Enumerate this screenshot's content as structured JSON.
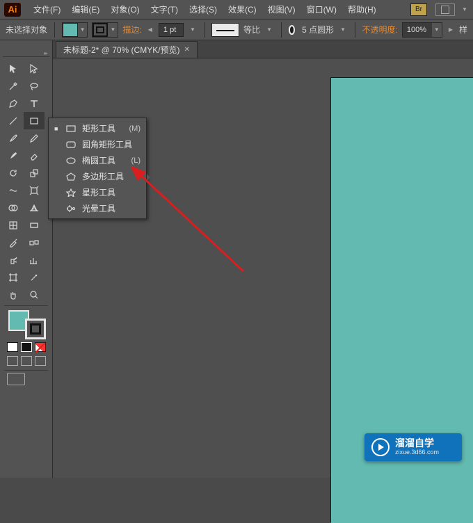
{
  "menubar": {
    "items": [
      "文件(F)",
      "编辑(E)",
      "对象(O)",
      "文字(T)",
      "选择(S)",
      "效果(C)",
      "视图(V)",
      "窗口(W)",
      "帮助(H)"
    ],
    "br_chip": "Br"
  },
  "controlbar": {
    "no_selection": "未选择对象",
    "stroke_label": "描边:",
    "stroke_value": "1 pt",
    "uniform_label": "等比",
    "brush_label": "5 点圆形",
    "opacity_label": "不透明度:",
    "opacity_value": "100%",
    "style_label": "样"
  },
  "tab": {
    "title": "未标题-2* @ 70% (CMYK/预览)"
  },
  "flyout": {
    "items": [
      {
        "label": "矩形工具",
        "shortcut": "(M)",
        "selected": true
      },
      {
        "label": "圆角矩形工具",
        "shortcut": ""
      },
      {
        "label": "椭圆工具",
        "shortcut": "(L)"
      },
      {
        "label": "多边形工具",
        "shortcut": ""
      },
      {
        "label": "星形工具",
        "shortcut": ""
      },
      {
        "label": "光晕工具",
        "shortcut": ""
      }
    ]
  },
  "badge": {
    "title": "溜溜自学",
    "sub": "zixue.3d66.com"
  },
  "colors": {
    "artboard": "#62bab0",
    "accent": "#e58b35"
  }
}
